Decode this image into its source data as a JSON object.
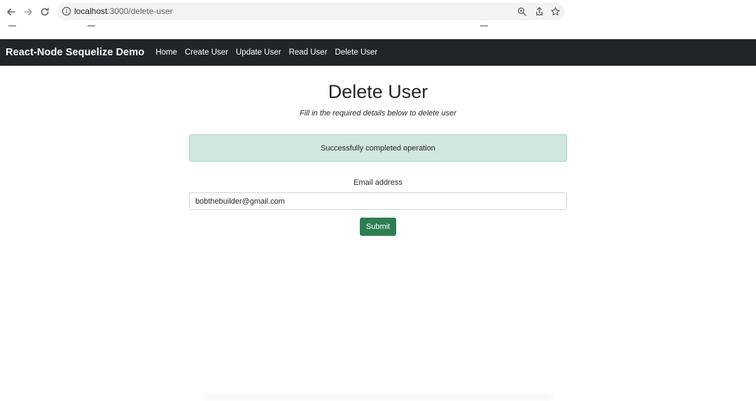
{
  "browser": {
    "url_host": "localhost",
    "url_path": ":3000/delete-user",
    "icons": {
      "back": "arrow-left-icon",
      "forward": "arrow-right-icon",
      "reload": "reload-icon",
      "site_info": "info-circle-icon",
      "zoom": "magnifier-icon",
      "share": "share-icon",
      "bookmark": "star-icon"
    }
  },
  "navbar": {
    "brand": "React-Node Sequelize Demo",
    "links": [
      "Home",
      "Create User",
      "Update User",
      "Read User",
      "Delete User"
    ],
    "background": "#212529"
  },
  "main": {
    "title": "Delete User",
    "subtitle": "Fill in the required details below to delete user",
    "alert": {
      "text": "Successfully completed operation",
      "color": "#d1e7dd"
    },
    "form": {
      "email_label": "Email address",
      "email_value": "bobthebuilder@gmail.com",
      "submit_label": "Submit",
      "submit_color": "#2e7d52"
    }
  }
}
